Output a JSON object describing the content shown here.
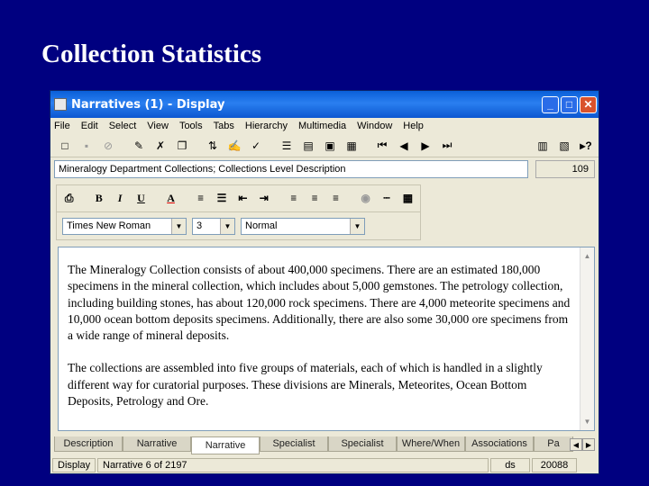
{
  "slide": {
    "title": "Collection Statistics"
  },
  "window": {
    "title": "Narratives (1) - Display",
    "buttons": {
      "minimize": "_",
      "maximize": "□",
      "close": "✕"
    }
  },
  "menu": [
    "File",
    "Edit",
    "Select",
    "View",
    "Tools",
    "Tabs",
    "Hierarchy",
    "Multimedia",
    "Window",
    "Help"
  ],
  "description": {
    "value": "Mineralogy Department Collections; Collections Level Description",
    "number": "109"
  },
  "format": {
    "font": "Times New Roman",
    "size": "3",
    "style": "Normal"
  },
  "narrative": {
    "paragraphs": [
      "The Mineralogy Collection consists of about 400,000 specimens. There are an estimated 180,000 specimens in the mineral collection, which includes about 5,000 gemstones. The petrology collection, including building stones, has about 120,000 rock specimens. There are 4,000 meteorite specimens and 10,000 ocean bottom deposits specimens. Additionally, there are also some 30,000 ore specimens from a wide range of mineral deposits.",
      "The collections are assembled into five groups of materials, each of which is handled in a slightly different way for curatorial purposes. These divisions are Minerals, Meteorites, Ocean Bottom Deposits, Petrology and Ore."
    ]
  },
  "tabs": [
    "Description",
    "Narrative",
    "Narrative",
    "Specialist",
    "Specialist",
    "Where/When",
    "Associations",
    "Pa"
  ],
  "status": {
    "mode": "Display",
    "record": "Narrative 6 of 2197",
    "user": "ds",
    "id": "20088"
  }
}
